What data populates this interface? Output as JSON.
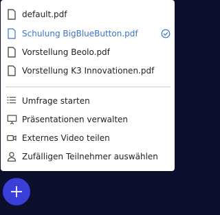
{
  "presentations": [
    {
      "label": "default.pdf",
      "selected": false
    },
    {
      "label": "Schulung BigBlueButton.pdf",
      "selected": true
    },
    {
      "label": "Vorstellung Beolo.pdf",
      "selected": false
    },
    {
      "label": "Vorstellung K3 Innovationen.pdf",
      "selected": false
    }
  ],
  "actions": [
    {
      "label": "Umfrage starten",
      "icon": "poll-list-icon"
    },
    {
      "label": "Präsentationen verwalten",
      "icon": "presentation-screen-icon"
    },
    {
      "label": "Externes Video teilen",
      "icon": "video-camera-icon"
    },
    {
      "label": "Zufälligen Teilnehmer auswählen",
      "icon": "user-icon"
    }
  ],
  "fab_icon": "plus-icon",
  "colors": {
    "background": "#0b0f2c",
    "selected_text": "#3b73c8",
    "fab": "#3a3fd8"
  }
}
